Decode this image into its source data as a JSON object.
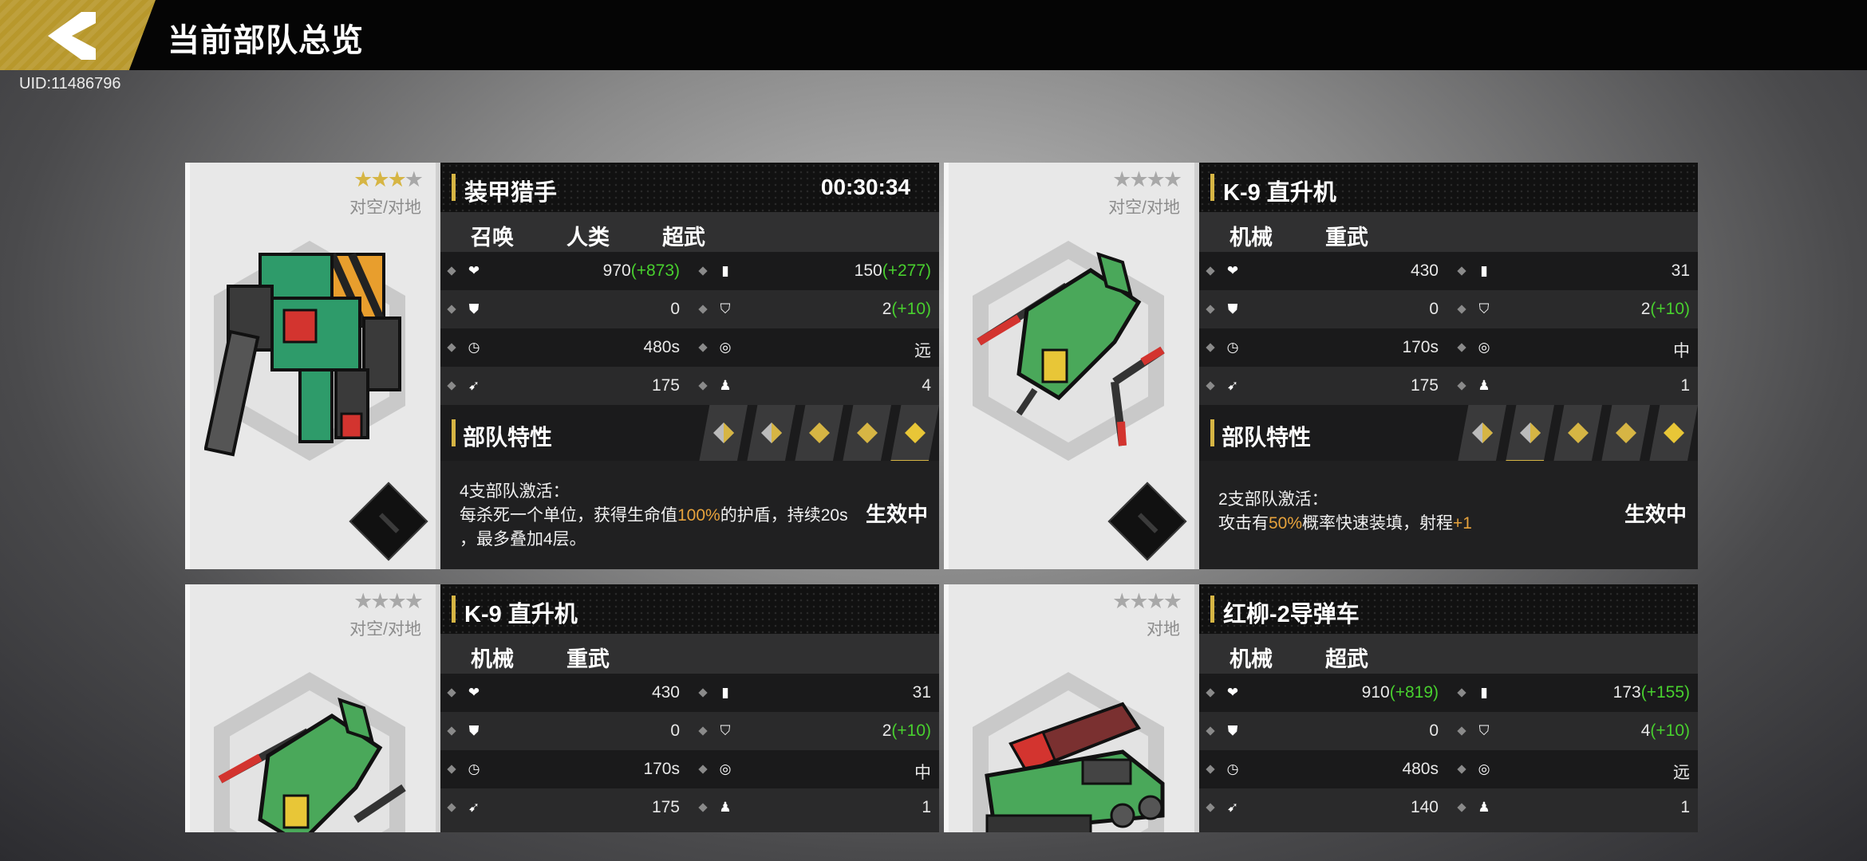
{
  "header": {
    "title": "当前部队总览",
    "back_icon": "back-arrow-icon"
  },
  "uid": "UID:11486796",
  "colors": {
    "accent": "#d6b544",
    "bonus": "#48d02e",
    "highlight": "#e6a23c"
  },
  "cards": [
    {
      "stars": 3,
      "role": "对空/对地",
      "name": "装甲猎手",
      "timer": "00:30:34",
      "tags": [
        "召唤",
        "人类",
        "超武"
      ],
      "stats": {
        "hp": "970",
        "hp_bonus": "(+873)",
        "atk": "150",
        "atk_bonus": "(+277)",
        "armor": "0",
        "shield": "2",
        "shield_bonus": "(+10)",
        "cooldown": "480s",
        "range": "远",
        "speed": "175",
        "count": "4"
      },
      "trait_label": "部队特性",
      "trait_level": 5,
      "desc": {
        "line1": "4支部队激活：",
        "line2a": "每杀死一个单位，获得生命值",
        "line2b": "100%",
        "line2c": "的护盾，持续20s",
        "line3": "，最多叠加4层。",
        "status": "生效中"
      }
    },
    {
      "stars": 0,
      "role": "对空/对地",
      "name": "K-9 直升机",
      "timer": "",
      "tags": [
        "机械",
        "重武"
      ],
      "stats": {
        "hp": "430",
        "hp_bonus": "",
        "atk": "31",
        "atk_bonus": "",
        "armor": "0",
        "shield": "2",
        "shield_bonus": "(+10)",
        "cooldown": "170s",
        "range": "中",
        "speed": "175",
        "count": "1"
      },
      "trait_label": "部队特性",
      "trait_level": 2,
      "desc": {
        "line1": "2支部队激活：",
        "line2a": "攻击有",
        "line2b": "50%",
        "line2c": "概率快速装填，射程",
        "line2d": "+1",
        "status": "生效中"
      }
    },
    {
      "stars": 0,
      "role": "对空/对地",
      "name": "K-9 直升机",
      "timer": "",
      "tags": [
        "机械",
        "重武"
      ],
      "stats": {
        "hp": "430",
        "hp_bonus": "",
        "atk": "31",
        "atk_bonus": "",
        "armor": "0",
        "shield": "2",
        "shield_bonus": "(+10)",
        "cooldown": "170s",
        "range": "中",
        "speed": "175",
        "count": "1"
      }
    },
    {
      "stars": 0,
      "role": "对地",
      "name": "红柳-2导弹车",
      "timer": "",
      "tags": [
        "机械",
        "超武"
      ],
      "stats": {
        "hp": "910",
        "hp_bonus": "(+819)",
        "atk": "173",
        "atk_bonus": "(+155)",
        "armor": "0",
        "shield": "4",
        "shield_bonus": "(+10)",
        "cooldown": "480s",
        "range": "远",
        "speed": "140",
        "count": "1"
      }
    }
  ]
}
